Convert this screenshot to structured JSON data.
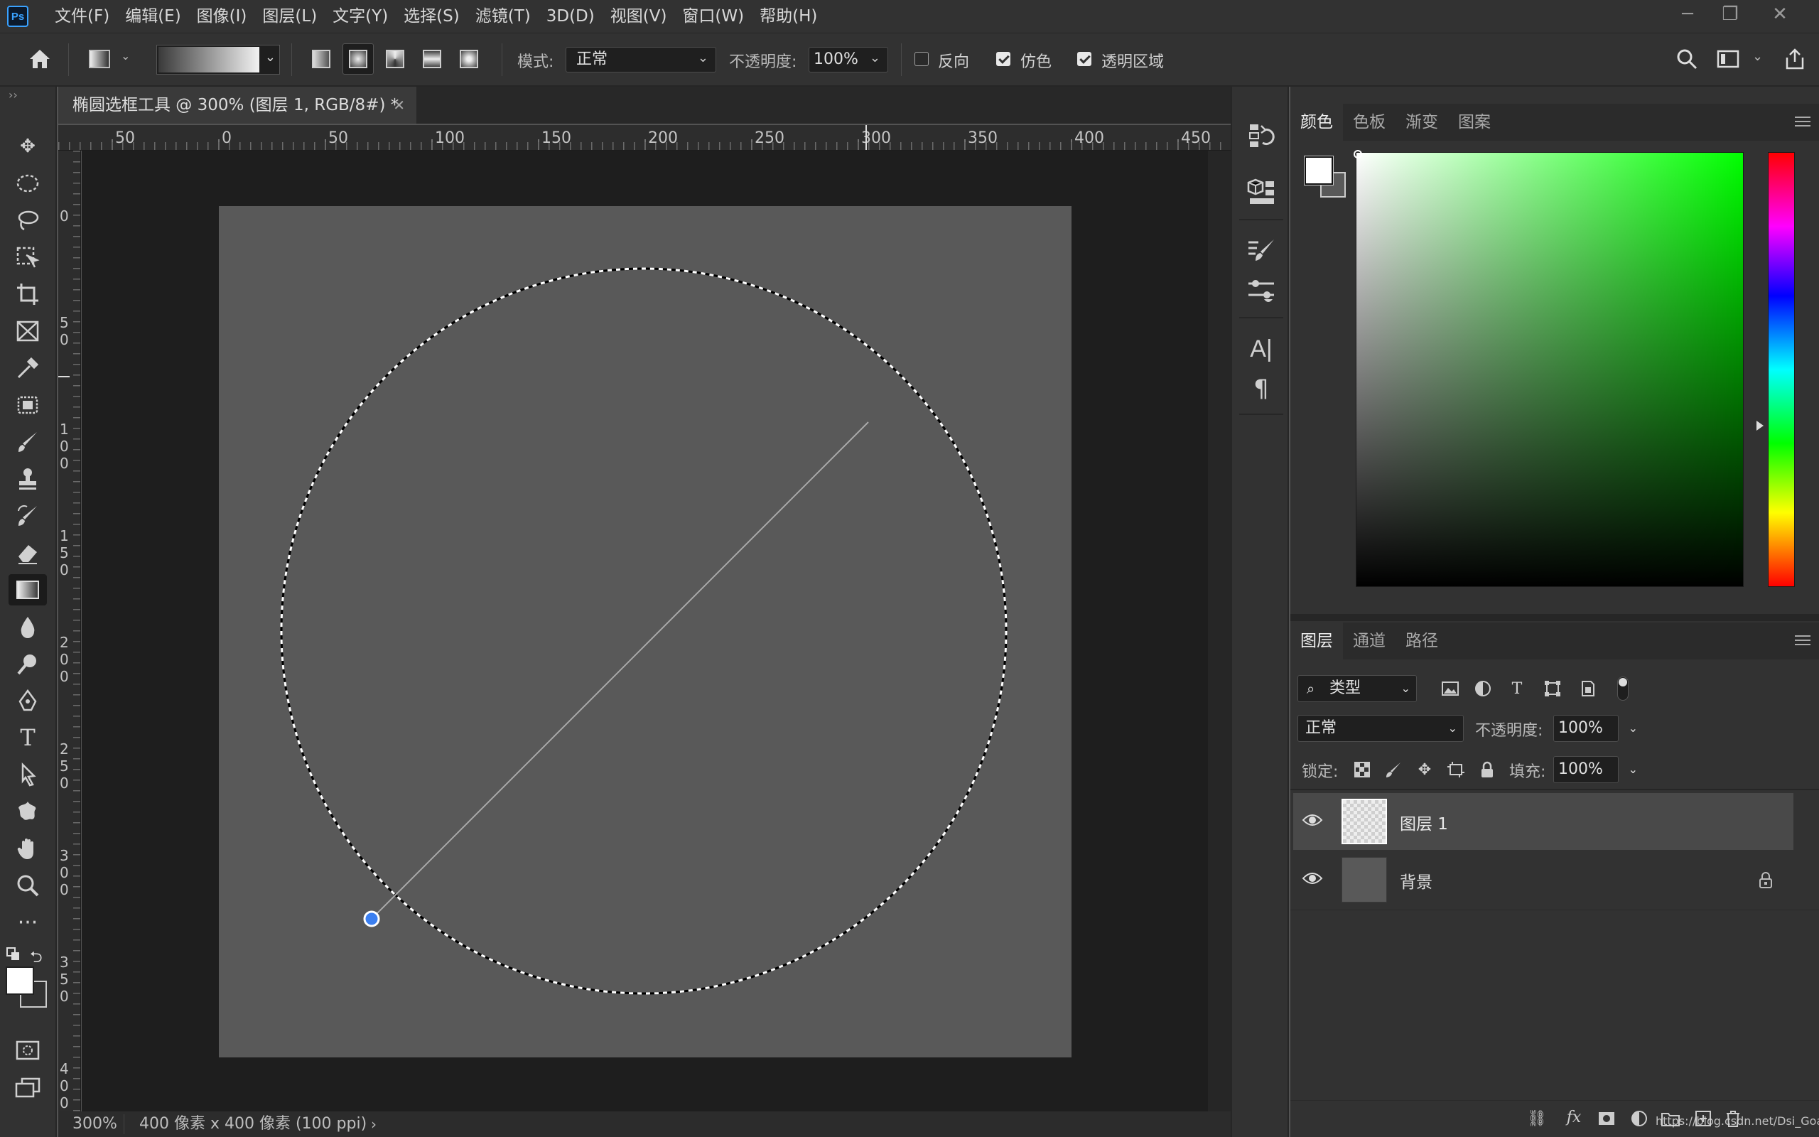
{
  "app": {
    "logo": "Ps"
  },
  "menu": [
    "文件(F)",
    "编辑(E)",
    "图像(I)",
    "图层(L)",
    "文字(Y)",
    "选择(S)",
    "滤镜(T)",
    "3D(D)",
    "视图(V)",
    "窗口(W)",
    "帮助(H)"
  ],
  "options": {
    "mode_label": "模式:",
    "mode_value": "正常",
    "opacity_label": "不透明度:",
    "opacity_value": "100%",
    "reverse_label": "反向",
    "reverse_checked": false,
    "dither_label": "仿色",
    "dither_checked": true,
    "transparency_label": "透明区域",
    "transparency_checked": true
  },
  "document": {
    "tab_title": "椭圆选框工具 @ 300% (图层 1, RGB/8#) *",
    "zoom": "300%",
    "info": "400 像素 x 400 像素 (100 ppi)",
    "ruler_h_labels": [
      "50",
      "0",
      "50",
      "100",
      "150",
      "200",
      "250",
      "300",
      "350",
      "400",
      "450"
    ],
    "ruler_v_labels": [
      "0",
      "50",
      "100",
      "150",
      "200",
      "250",
      "300",
      "350",
      "400"
    ]
  },
  "color_panel": {
    "tabs": [
      "颜色",
      "色板",
      "渐变",
      "图案"
    ],
    "foreground": "#ffffff",
    "background": "#595959",
    "hue_color": "#00ff00"
  },
  "layers_panel": {
    "tabs": [
      "图层",
      "通道",
      "路径"
    ],
    "filter_label": "类型",
    "blend_mode": "正常",
    "opacity_label": "不透明度:",
    "opacity_value": "100%",
    "lock_label": "锁定:",
    "fill_label": "填充:",
    "fill_value": "100%",
    "layers": [
      {
        "name": "图层 1",
        "selected": true,
        "visible": true
      },
      {
        "name": "背景",
        "selected": false,
        "visible": true,
        "locked": true
      }
    ]
  },
  "watermark": "https://blog.csdn.net/Dsi_Goat"
}
